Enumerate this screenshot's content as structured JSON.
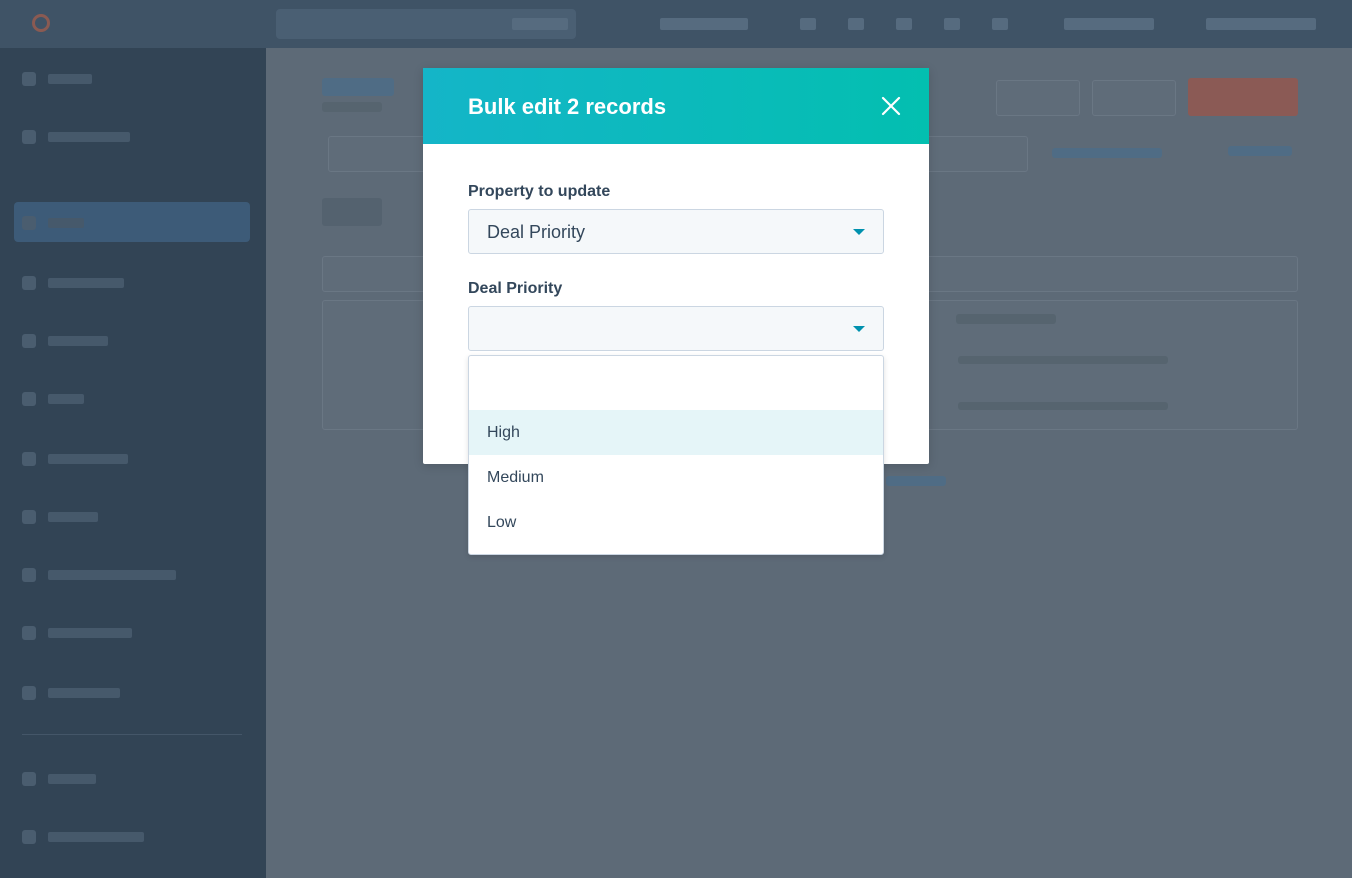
{
  "modal": {
    "title": "Bulk edit 2 records",
    "close_icon": "close-icon",
    "property_label": "Property to update",
    "property_value": "Deal Priority",
    "value_label": "Deal Priority",
    "value_current": "",
    "dropdown": {
      "search_placeholder": "",
      "options": [
        "High",
        "Medium",
        "Low"
      ],
      "highlighted": "High"
    }
  },
  "colors": {
    "header_gradient_start": "#14b5c8",
    "header_gradient_end": "#03bfb0",
    "caret": "#0091ae",
    "text": "#33475b",
    "highlight": "#e5f5f8",
    "overlay": "#5d6a77"
  }
}
